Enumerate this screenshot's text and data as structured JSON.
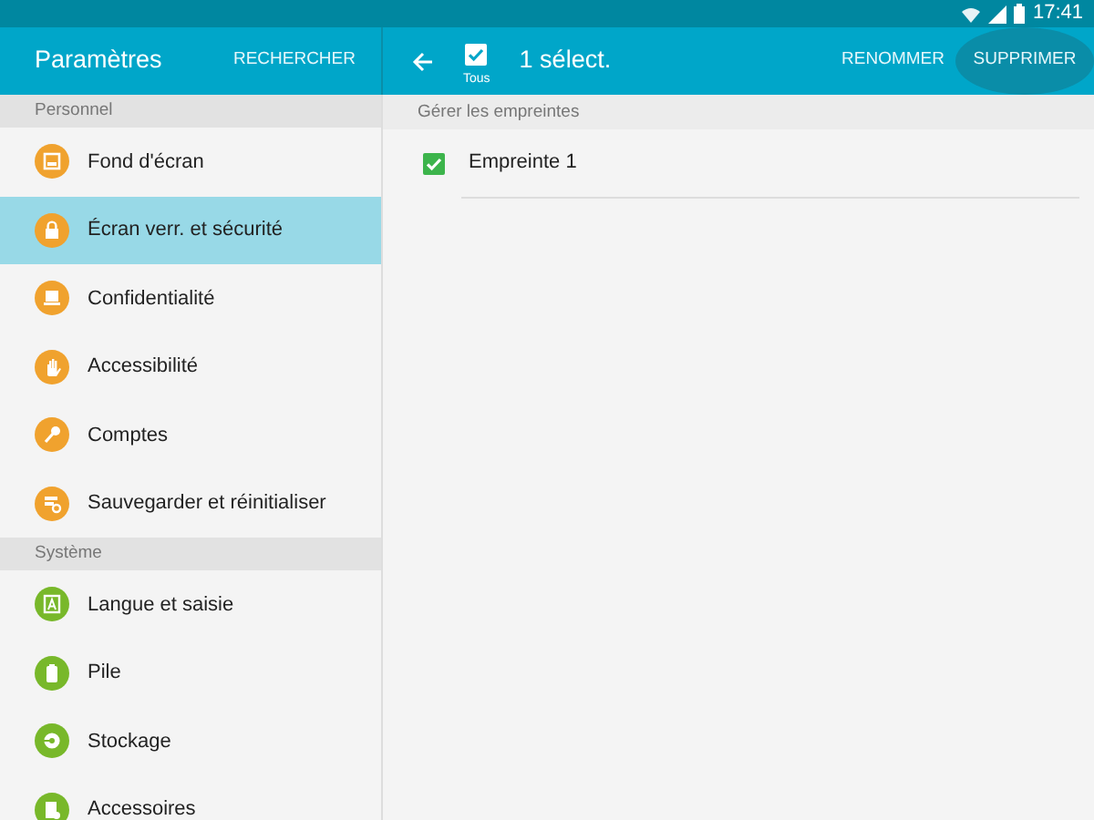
{
  "status_bar": {
    "time": "17:41"
  },
  "sidebar": {
    "title": "Paramètres",
    "action": "RECHERCHER",
    "sections": [
      {
        "header": "Personnel",
        "color": "#f0a22e",
        "items": [
          {
            "label": "Fond d'écran",
            "selected": false
          },
          {
            "label": "Écran verr. et sécurité",
            "selected": true
          },
          {
            "label": "Confidentialité",
            "selected": false
          },
          {
            "label": "Accessibilité",
            "selected": false
          },
          {
            "label": "Comptes",
            "selected": false
          },
          {
            "label": "Sauvegarder et réinitialiser",
            "selected": false
          }
        ]
      },
      {
        "header": "Système",
        "color": "#78b82a",
        "items": [
          {
            "label": "Langue et saisie",
            "selected": false
          },
          {
            "label": "Pile",
            "selected": false
          },
          {
            "label": "Stockage",
            "selected": false
          },
          {
            "label": "Accessoires",
            "selected": false
          }
        ]
      }
    ]
  },
  "toolbar": {
    "select_all": {
      "label": "Tous",
      "checked": true
    },
    "title": "1 sélect.",
    "actions": [
      {
        "label": "RENOMMER",
        "pressed": false
      },
      {
        "label": "SUPPRIMER",
        "pressed": true
      }
    ]
  },
  "content": {
    "header": "Gérer les empreintes",
    "items": [
      {
        "label": "Empreinte 1",
        "checked": true
      }
    ]
  }
}
